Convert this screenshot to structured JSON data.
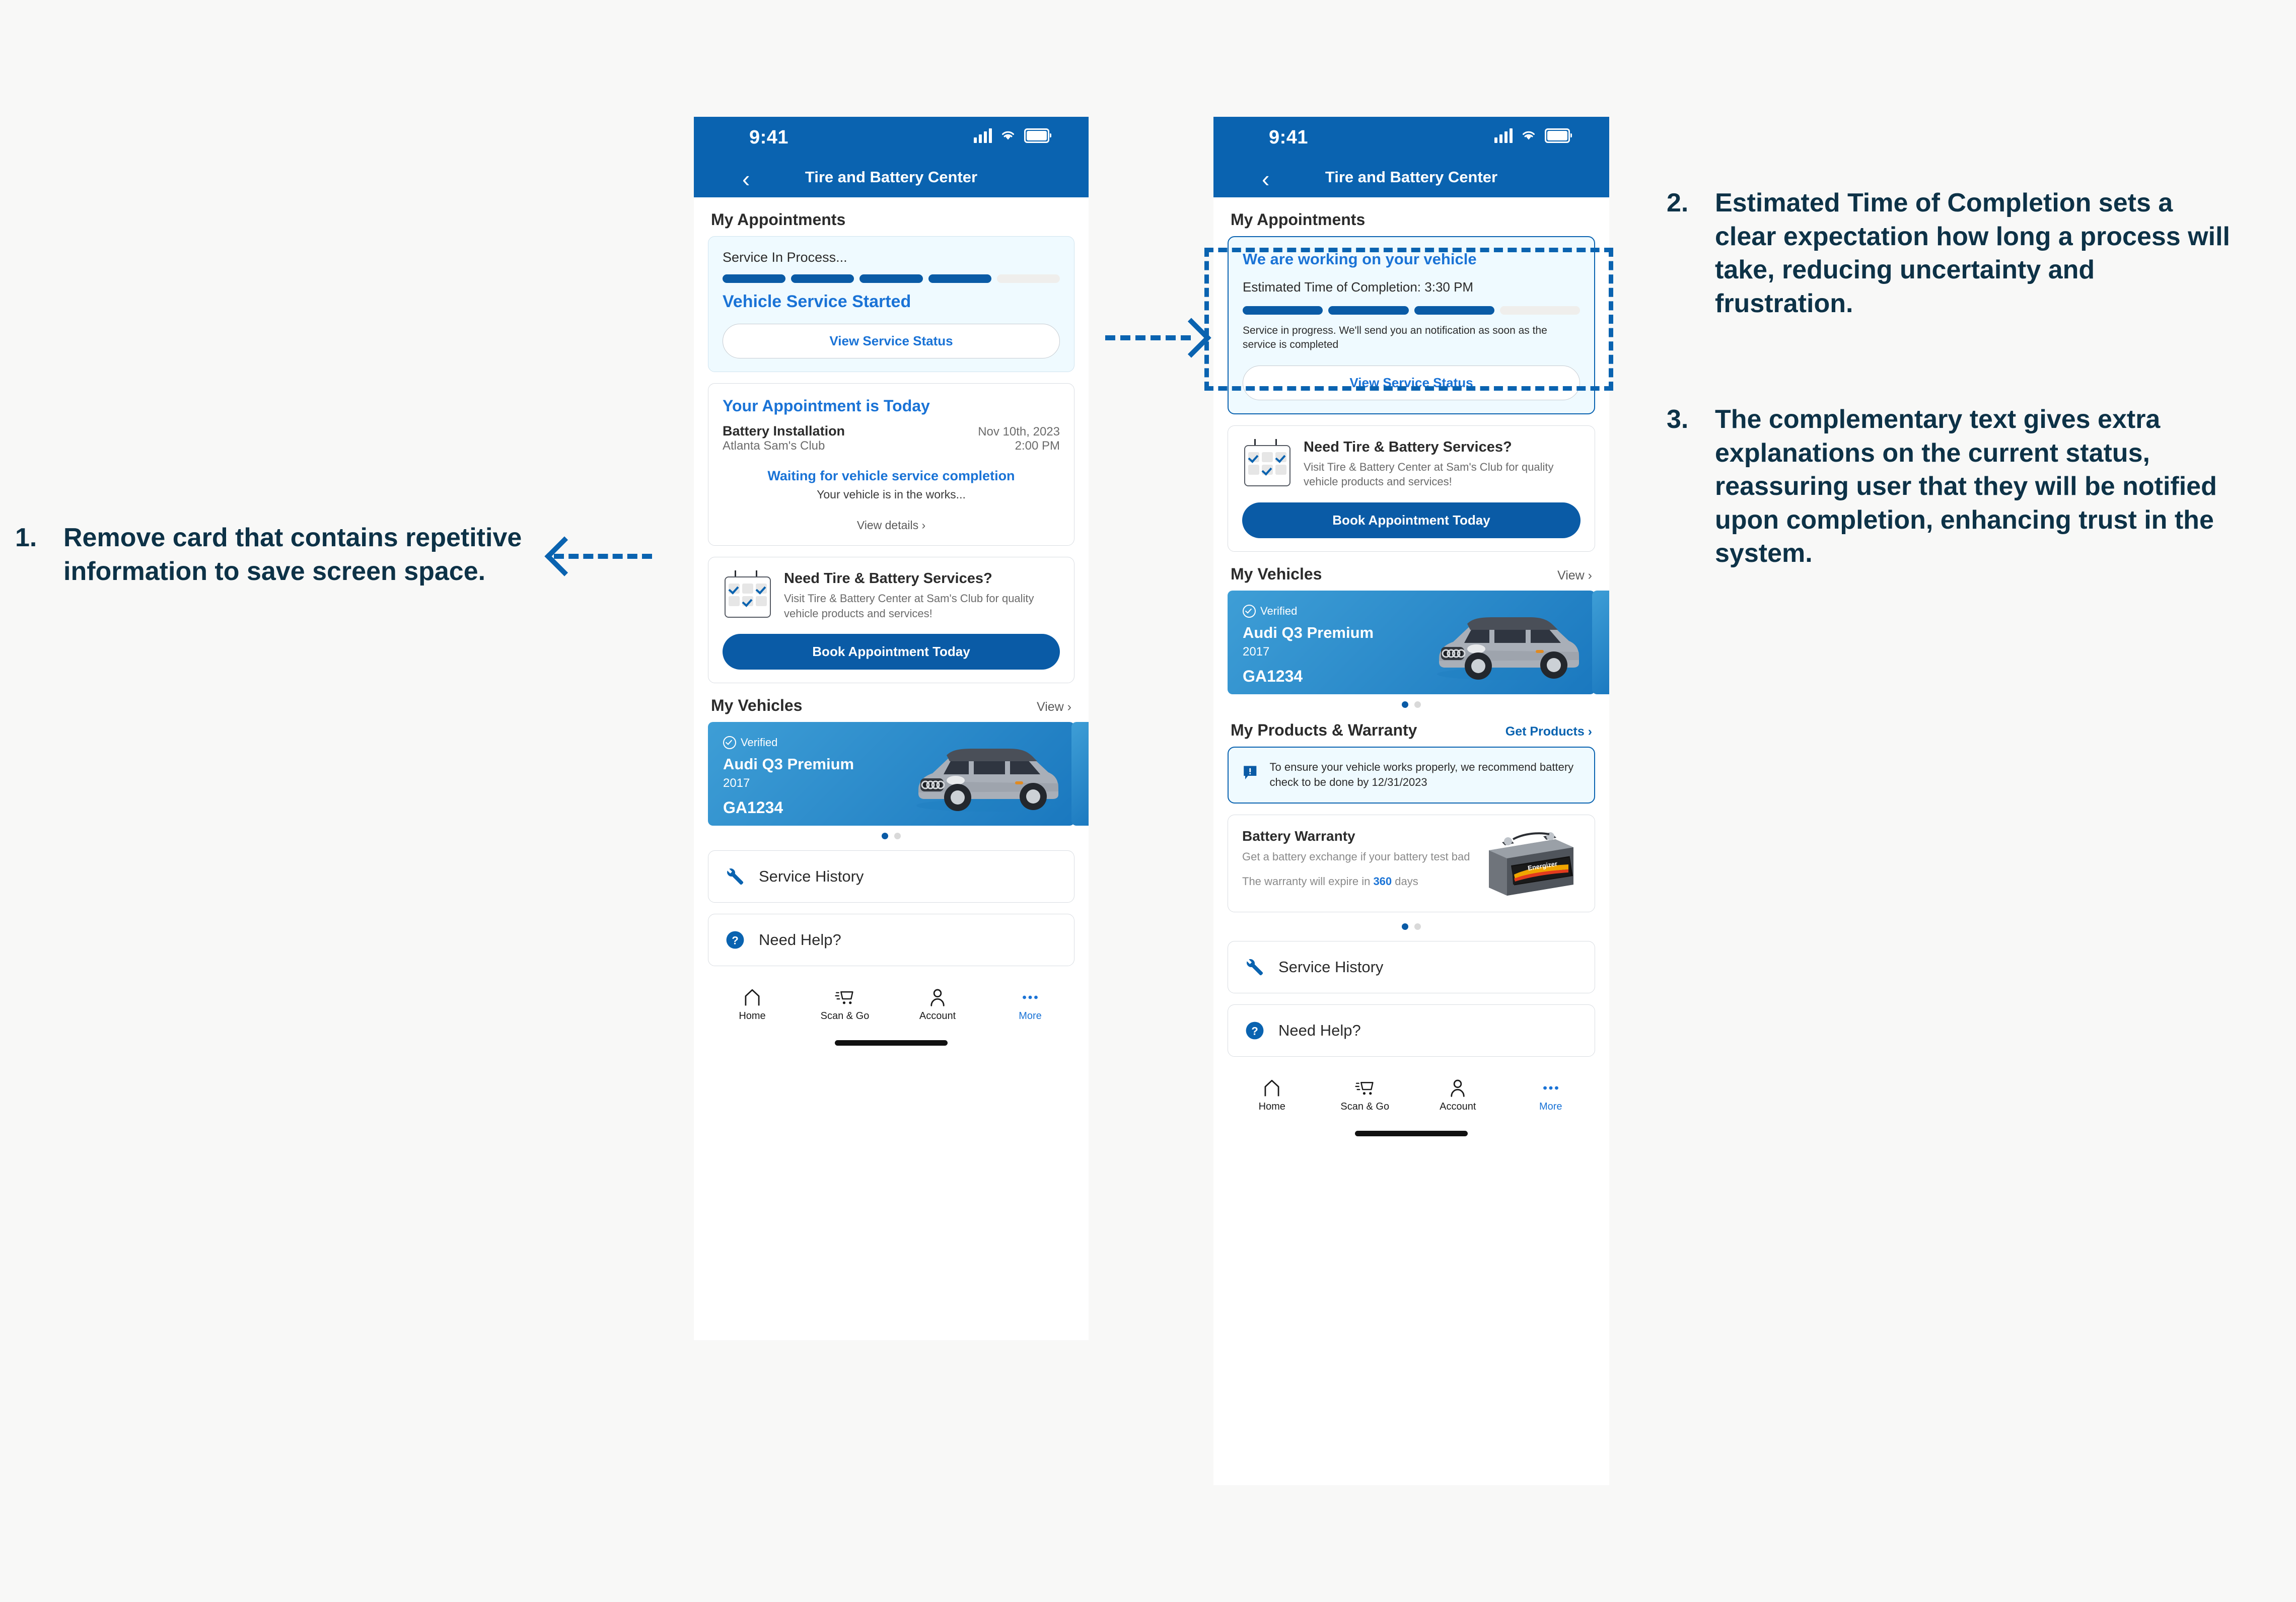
{
  "canvas": {
    "background": "#f8f8f7",
    "accent": "#0a63b0",
    "link_blue": "#1a73d6"
  },
  "status_bar": {
    "time": "9:41",
    "cellular_icon": "signal-bars-icon",
    "wifi_icon": "wifi-icon",
    "battery_icon": "battery-full-icon"
  },
  "nav_bar": {
    "back_icon": "chevron-left-icon",
    "title": "Tire and Battery Center"
  },
  "phone_a": {
    "appointments_heading": "My Appointments",
    "service_card": {
      "progress_label": "Service In Process...",
      "segments_total": 5,
      "segments_filled": 4,
      "status": "Vehicle Service Started",
      "button": "View Service Status"
    },
    "appointment_card": {
      "title": "Your Appointment is Today",
      "service": "Battery Installation",
      "date": "Nov 10th, 2023",
      "location": "Atlanta Sam's Club",
      "time": "2:00 PM",
      "waiting": "Waiting for vehicle service completion",
      "waiting_sub": "Your vehicle is in the works...",
      "view_details": "View details ›"
    },
    "promo_card": {
      "title": "Need Tire & Battery Services?",
      "subtitle": "Visit Tire & Battery Center at Sam's Club for quality vehicle products and services!",
      "button": "Book Appointment Today",
      "icon": "calendar-checks-icon"
    },
    "vehicles": {
      "heading": "My Vehicles",
      "link": "View ›",
      "verified": "Verified",
      "name": "Audi Q3 Premium",
      "year": "2017",
      "plate": "GA1234",
      "pager_dots": 2,
      "pager_active": 1
    },
    "rows": [
      {
        "label": "Service History",
        "icon": "wrench-icon"
      },
      {
        "label": "Need Help?",
        "icon": "question-circle-icon"
      }
    ],
    "tabs": [
      {
        "label": "Home",
        "icon": "home-icon",
        "active": false
      },
      {
        "label": "Scan & Go",
        "icon": "scan-cart-icon",
        "active": false
      },
      {
        "label": "Account",
        "icon": "person-icon",
        "active": false
      },
      {
        "label": "More",
        "icon": "ellipsis-icon",
        "active": true
      }
    ]
  },
  "phone_b": {
    "appointments_heading": "My Appointments",
    "service_card": {
      "title": "We are working on your vehicle",
      "eta": "Estimated Time of Completion: 3:30 PM",
      "segments_total": 4,
      "segments_filled": 3,
      "note": "Service in progress. We'll send you an notification as soon as the service is completed",
      "button": "View Service Status"
    },
    "promo_card": {
      "title": "Need Tire & Battery Services?",
      "subtitle": "Visit Tire & Battery Center at Sam's Club for quality vehicle products and services!",
      "button": "Book Appointment Today",
      "icon": "calendar-checks-icon"
    },
    "vehicles": {
      "heading": "My Vehicles",
      "link": "View ›",
      "verified": "Verified",
      "name": "Audi Q3 Premium",
      "year": "2017",
      "plate": "GA1234",
      "pager_dots": 2,
      "pager_active": 1
    },
    "warranty": {
      "heading": "My Products & Warranty",
      "link": "Get Products ›",
      "alert_icon": "exclamation-callout-icon",
      "alert_text": "To ensure your vehicle works properly, we recommend battery check to be done by 12/31/2023",
      "card_title": "Battery Warranty",
      "card_sub": "Get a battery exchange if your battery test bad",
      "expire_prefix": "The warranty will expire in ",
      "expire_days": "360",
      "expire_suffix": " days",
      "product_image": "car-battery-image",
      "pager_dots": 2,
      "pager_active": 1
    },
    "rows": [
      {
        "label": "Service History",
        "icon": "wrench-icon"
      },
      {
        "label": "Need Help?",
        "icon": "question-circle-icon"
      }
    ],
    "tabs": [
      {
        "label": "Home",
        "icon": "home-icon",
        "active": false
      },
      {
        "label": "Scan & Go",
        "icon": "scan-cart-icon",
        "active": false
      },
      {
        "label": "Account",
        "icon": "person-icon",
        "active": false
      },
      {
        "label": "More",
        "icon": "ellipsis-icon",
        "active": true
      }
    ]
  },
  "annotations": [
    {
      "num": "1.",
      "text": "Remove card that contains repetitive information to save screen space."
    },
    {
      "num": "2.",
      "text": "Estimated Time of Completion sets a clear expectation how long a process will take, reducing uncertainty and frustration."
    },
    {
      "num": "3.",
      "text": "The complementary text gives extra explanations on the current status, reassuring user that they will be notified upon completion, enhancing trust in the system."
    }
  ]
}
